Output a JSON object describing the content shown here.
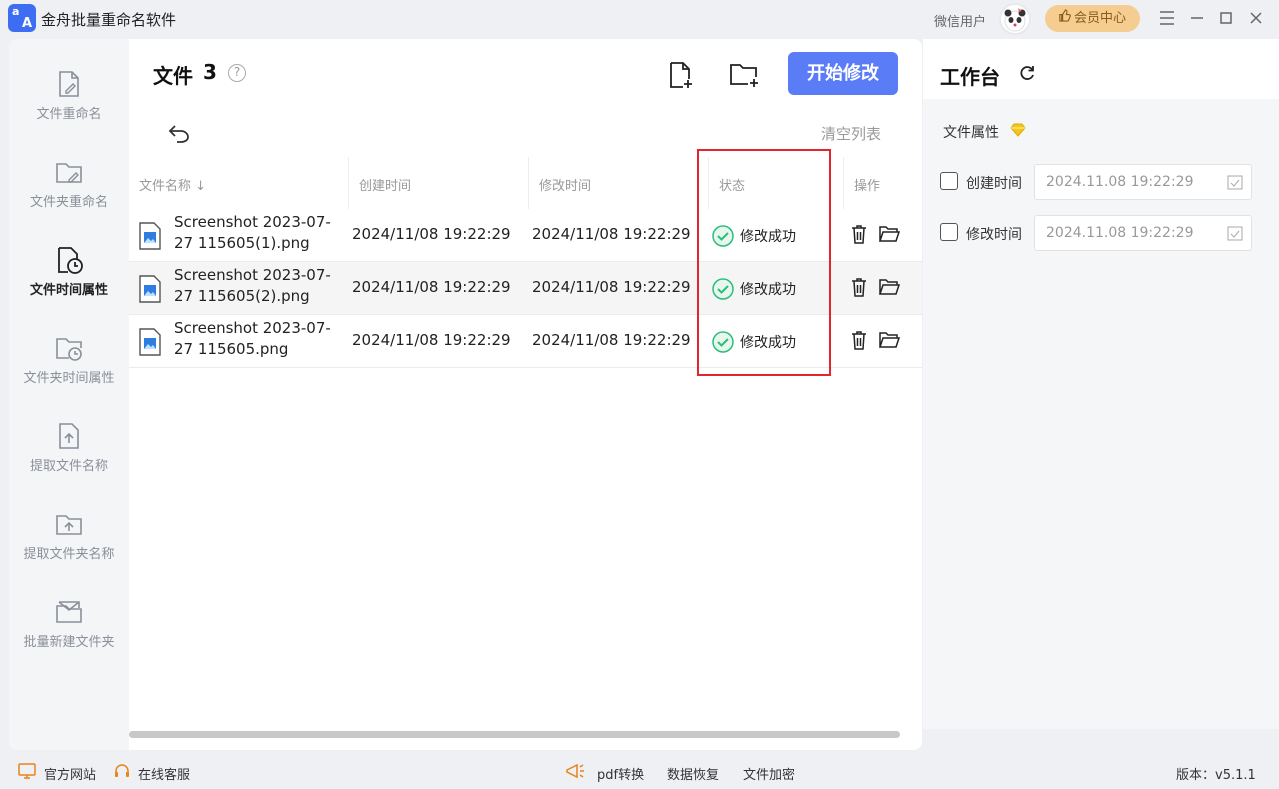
{
  "app": {
    "logo_top": "a",
    "logo_bottom": "A",
    "title": "金舟批量重命名软件",
    "user_label": "微信用户",
    "vip_label": "会员中心"
  },
  "sidebar": {
    "items": [
      {
        "label": "文件重命名",
        "icon": "file-edit-icon",
        "active": false
      },
      {
        "label": "文件夹重命名",
        "icon": "folder-edit-icon",
        "active": false
      },
      {
        "label": "文件时间属性",
        "icon": "file-clock-icon",
        "active": true
      },
      {
        "label": "文件夹时间属性",
        "icon": "folder-clock-icon",
        "active": false
      },
      {
        "label": "提取文件名称",
        "icon": "file-upload-icon",
        "active": false
      },
      {
        "label": "提取文件夹名称",
        "icon": "folder-upload-icon",
        "active": false
      },
      {
        "label": "批量新建文件夹",
        "icon": "mail-folder-icon",
        "active": false
      }
    ]
  },
  "main": {
    "title": "文件",
    "count": "3",
    "help": "?",
    "start_button": "开始修改",
    "clear_list": "清空列表",
    "columns": {
      "name": "文件名称 ↓",
      "created": "创建时间",
      "modified": "修改时间",
      "status": "状态",
      "actions": "操作"
    },
    "rows": [
      {
        "name_line1": "Screenshot 2023-07-",
        "name_line2": "27 115605(1).png",
        "created": "2024/11/08 19:22:29",
        "modified": "2024/11/08 19:22:29",
        "status": "修改成功"
      },
      {
        "name_line1": "Screenshot 2023-07-",
        "name_line2": "27 115605(2).png",
        "created": "2024/11/08 19:22:29",
        "modified": "2024/11/08 19:22:29",
        "status": "修改成功"
      },
      {
        "name_line1": "Screenshot 2023-07-",
        "name_line2": "27 115605.png",
        "created": "2024/11/08 19:22:29",
        "modified": "2024/11/08 19:22:29",
        "status": "修改成功"
      }
    ]
  },
  "workbench": {
    "title": "工作台",
    "attr_label": "文件属性",
    "created_label": "创建时间",
    "created_value": "2024.11.08 19:22:29",
    "modified_label": "修改时间",
    "modified_value": "2024.11.08 19:22:29"
  },
  "footer": {
    "website": "官方网站",
    "support": "在线客服",
    "pdf": "pdf转换",
    "recovery": "数据恢复",
    "encrypt": "文件加密",
    "version": "版本：v5.1.1"
  },
  "colors": {
    "accent": "#5b7cf7",
    "success": "#2dbd7a",
    "highlight_box": "#e3262b",
    "vip": "#f5cd90"
  }
}
